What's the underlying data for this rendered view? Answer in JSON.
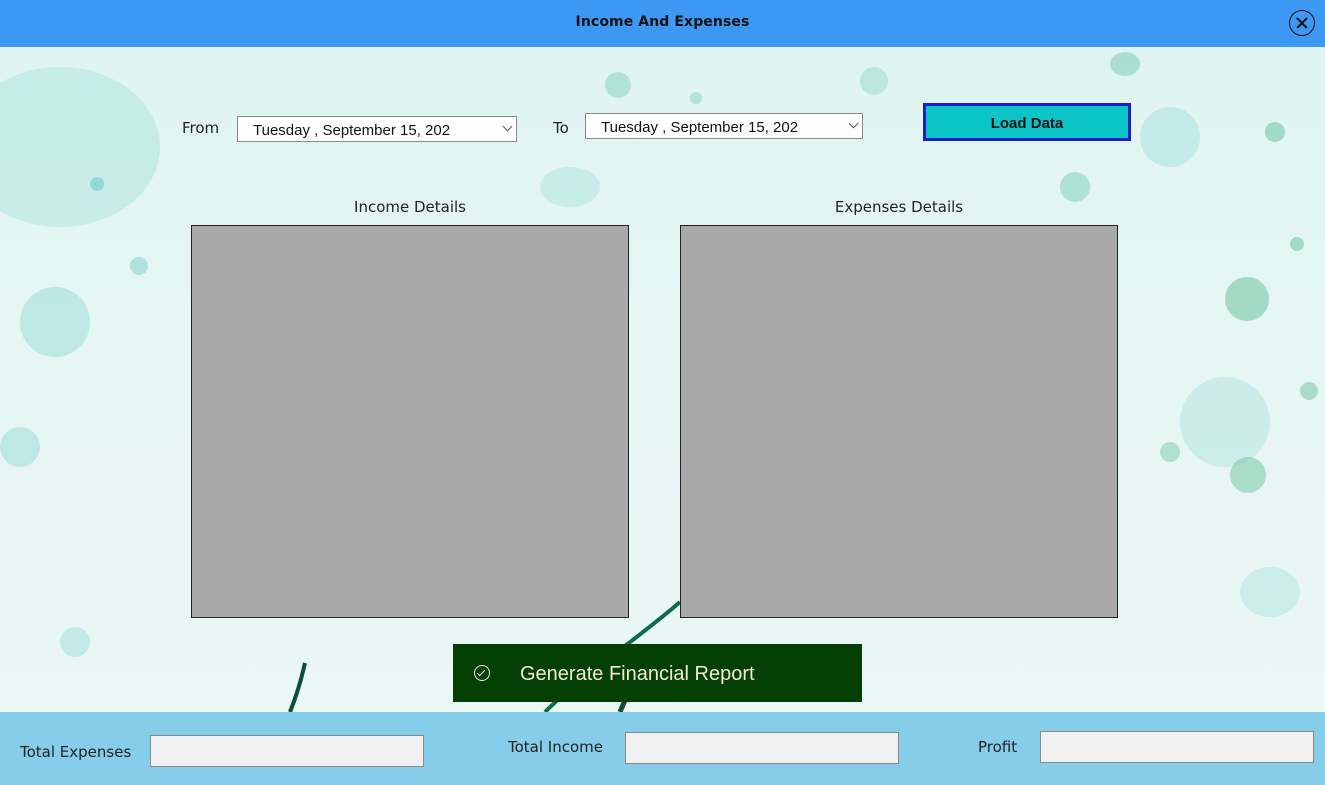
{
  "window": {
    "title": "Income And Expenses",
    "close_icon": "close-circle-icon"
  },
  "filters": {
    "from_label": "From",
    "from_date": "Tuesday   , September 15, 202",
    "to_label": "To",
    "to_date": "Tuesday   , September 15, 202",
    "load_label": "Load Data"
  },
  "panels": {
    "income_title": "Income Details",
    "expenses_title": "Expenses Details"
  },
  "report": {
    "label": "Generate Financial Report",
    "icon": "check-circle-icon"
  },
  "footer": {
    "total_expenses_label": "Total Expenses",
    "total_expenses_value": "",
    "total_income_label": "Total Income",
    "total_income_value": "",
    "profit_label": "Profit",
    "profit_value": ""
  },
  "colors": {
    "titlebar": "#3d98f4",
    "load_button": "#0ac4c8",
    "load_button_border": "#1e1ec8",
    "grid": "#a9a9a9",
    "report_button": "#043f04",
    "footer": "#86cdea"
  }
}
